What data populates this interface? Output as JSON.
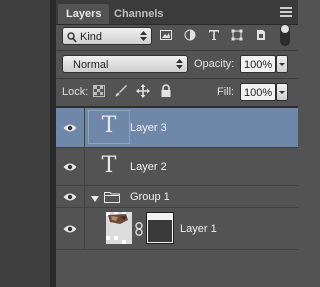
{
  "tabs": [
    {
      "label": "Layers"
    },
    {
      "label": "Channels"
    }
  ],
  "filter": {
    "kind_label": "Kind",
    "icons": [
      "pixel-filter-icon",
      "adjustment-filter-icon",
      "type-filter-icon",
      "shape-filter-icon",
      "smart-object-filter-icon"
    ]
  },
  "blend": {
    "mode": "Normal",
    "opacity_label": "Opacity:",
    "opacity_value": "100%"
  },
  "lock": {
    "label": "Lock:",
    "fill_label": "Fill:",
    "fill_value": "100%"
  },
  "layers": [
    {
      "name": "Layer 3",
      "kind": "type",
      "selected": true
    },
    {
      "name": "Layer 2",
      "kind": "type",
      "selected": false
    },
    {
      "name": "Group 1",
      "kind": "group",
      "selected": false
    },
    {
      "name": "Layer 1",
      "kind": "masked-image",
      "selected": false
    }
  ],
  "colors": {
    "panel_bg": "#535353",
    "selection": "#6f87a8",
    "header_bg": "#3b3b3b"
  }
}
